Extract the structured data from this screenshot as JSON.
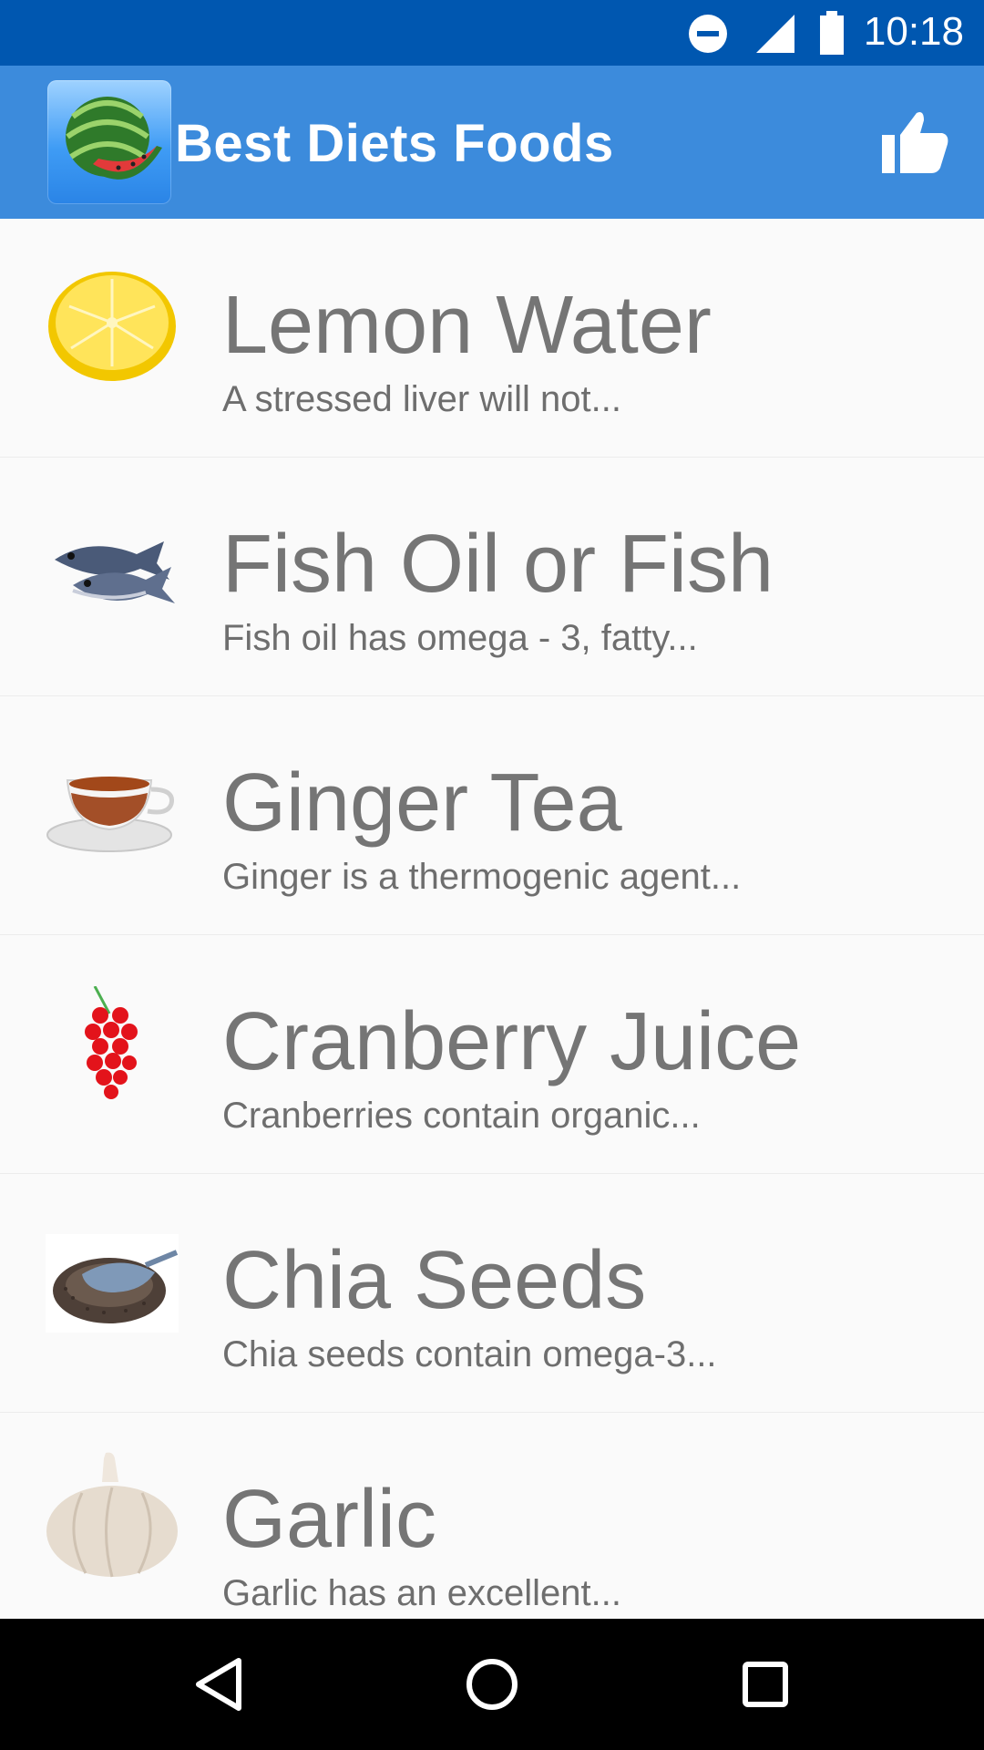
{
  "status_bar": {
    "time": "10:18",
    "icons": [
      "do-not-disturb-icon",
      "signal-icon",
      "battery-icon"
    ]
  },
  "app_bar": {
    "title": "Best Diets Foods",
    "logo_icon": "watermelon-icon",
    "action_icon": "thumbs-up-icon",
    "background": "#3c8bdc"
  },
  "list": {
    "items": [
      {
        "title": "Lemon Water",
        "subtitle": "A stressed liver will not...",
        "icon": "lemon-icon"
      },
      {
        "title": "Fish Oil or Fish",
        "subtitle": "Fish oil has omega - 3, fatty...",
        "icon": "fish-icon"
      },
      {
        "title": "Ginger Tea",
        "subtitle": "Ginger is a thermogenic agent...",
        "icon": "tea-cup-icon"
      },
      {
        "title": "Cranberry Juice",
        "subtitle": "Cranberries contain organic...",
        "icon": "cranberry-icon"
      },
      {
        "title": "Chia Seeds",
        "subtitle": "Chia seeds contain omega-3...",
        "icon": "chia-seeds-icon"
      },
      {
        "title": "Garlic",
        "subtitle": "Garlic has an excellent...",
        "icon": "garlic-icon"
      }
    ]
  },
  "nav_bar": {
    "buttons": [
      "back-icon",
      "home-icon",
      "recents-icon"
    ]
  },
  "colors": {
    "status_bar": "#0057b0",
    "app_bar": "#3c8bdc",
    "title_text": "#757575",
    "background": "#fafafa"
  }
}
